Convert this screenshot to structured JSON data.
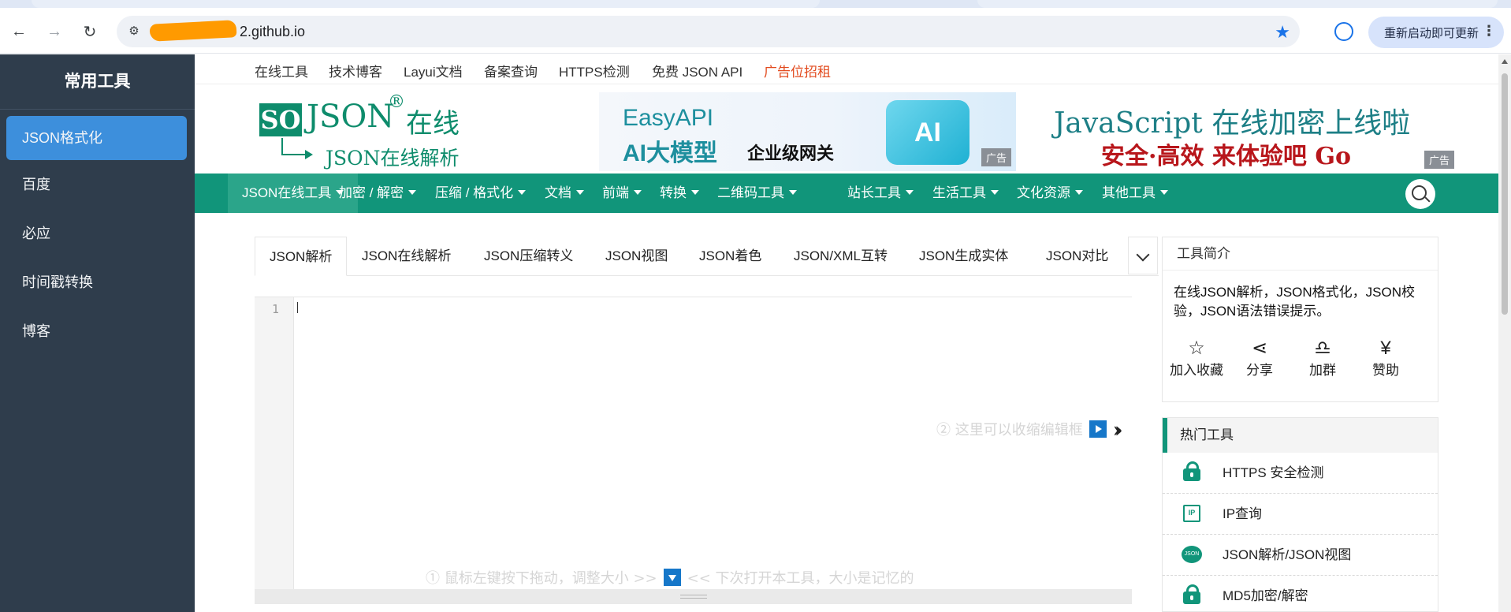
{
  "browser": {
    "url_visible": "2.github.io",
    "update_button": "重新启动即可更新"
  },
  "sidebar": {
    "title": "常用工具",
    "items": [
      {
        "label": "JSON格式化"
      },
      {
        "label": "百度"
      },
      {
        "label": "必应"
      },
      {
        "label": "时间戳转换"
      },
      {
        "label": "博客"
      }
    ]
  },
  "topnav": {
    "links": [
      "在线工具",
      "技术博客",
      "Layui文档",
      "备案查询",
      "HTTPS检测",
      "免费 JSON API",
      "广告位招租"
    ]
  },
  "header": {
    "logo": {
      "so": "SO",
      "json": "JSON",
      "reg": "®",
      "cn": "在线",
      "sub": "JSON在线解析"
    },
    "banner1": {
      "line1": "EasyAPI",
      "line2": "AI大模型",
      "line3": "企业级网关",
      "box": "AI",
      "adtag": "广告"
    },
    "banner2": {
      "line1": "JavaScript 在线加密上线啦",
      "line2": "安全·高效 来体验吧 Go",
      "adtag": "广告"
    }
  },
  "mainnav": {
    "items": [
      "JSON在线工具",
      "加密 / 解密",
      "压缩 / 格式化",
      "文档",
      "前端",
      "转换",
      "二维码工具",
      "站长工具",
      "生活工具",
      "文化资源",
      "其他工具"
    ]
  },
  "tabs": {
    "items": [
      "JSON解析",
      "JSON在线解析",
      "JSON压缩转义",
      "JSON视图",
      "JSON着色",
      "JSON/XML互转",
      "JSON生成实体",
      "JSON对比"
    ]
  },
  "editor": {
    "line_number": "1",
    "hint_collapse": "② 这里可以收缩编辑框",
    "hint_resize_a": "① 鼠标左键按下拖动，调整大小 >>",
    "hint_resize_b": "<< 下次打开本工具，大小是记忆的"
  },
  "intro": {
    "title": "工具简介",
    "description": "在线JSON解析，JSON格式化，JSON校验，JSON语法错误提示。",
    "actions": [
      {
        "icon": "star-icon",
        "glyph": "☆",
        "label": "加入收藏"
      },
      {
        "icon": "share-icon",
        "glyph": "⋖",
        "label": "分享"
      },
      {
        "icon": "group-icon",
        "glyph": "♎",
        "label": "加群"
      },
      {
        "icon": "yen-icon",
        "glyph": "¥",
        "label": "赞助"
      }
    ]
  },
  "hot": {
    "title": "热门工具",
    "items": [
      {
        "label": "HTTPS 安全检测",
        "icon": "lock-icon"
      },
      {
        "label": "IP查询",
        "icon": "ip-icon",
        "tag": "IP"
      },
      {
        "label": "JSON解析/JSON视图",
        "icon": "json-icon",
        "tag": "JSON"
      },
      {
        "label": "MD5加密/解密",
        "icon": "lock-icon"
      }
    ]
  },
  "colors": {
    "brand": "#11957a",
    "sidebar": "#2f3d4c",
    "sidebar_active": "#3d8fdc",
    "ad_link": "#e24b1f"
  }
}
